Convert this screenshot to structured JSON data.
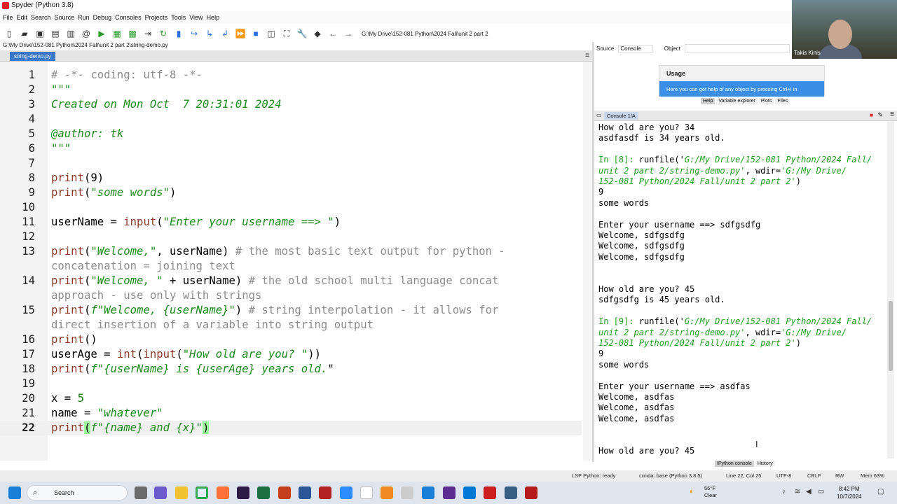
{
  "window": {
    "title": "Spyder (Python 3.8)"
  },
  "menu": [
    "File",
    "Edit",
    "Search",
    "Source",
    "Run",
    "Debug",
    "Consoles",
    "Projects",
    "Tools",
    "View",
    "Help"
  ],
  "toolbar": {
    "path": "G:\\My Drive\\152-081 Python\\2024 Fall\\unit 2 part 2"
  },
  "editor": {
    "file_path": "G:\\My Drive\\152-081 Python\\2024 Fall\\unit 2 part 2\\string-demo.py",
    "tab": "string-demo.py",
    "lines": [
      {
        "n": "1",
        "t": "# -*- coding: utf-8 -*-"
      },
      {
        "n": "2",
        "t": "\"\"\""
      },
      {
        "n": "3",
        "t": "Created on Mon Oct  7 20:31:01 2024"
      },
      {
        "n": "4",
        "t": ""
      },
      {
        "n": "5",
        "t": "@author: tk"
      },
      {
        "n": "6",
        "t": "\"\"\""
      },
      {
        "n": "7",
        "t": ""
      },
      {
        "n": "8",
        "t": "print(9)"
      },
      {
        "n": "9",
        "t": "print(\"some words\")"
      },
      {
        "n": "10",
        "t": ""
      },
      {
        "n": "11",
        "t": "userName = input(\"Enter your username ==> \")"
      },
      {
        "n": "12",
        "t": ""
      },
      {
        "n": "13",
        "t": "print(\"Welcome,\", userName) # the most basic text output for python -"
      },
      {
        "n": "",
        "t": "concatenation = joining text"
      },
      {
        "n": "14",
        "t": "print(\"Welcome, \" + userName) # the old school multi language concat"
      },
      {
        "n": "",
        "t": "approach - use only with strings"
      },
      {
        "n": "15",
        "t": "print(f\"Welcome, {userName}\") # string interpolation - it allows for"
      },
      {
        "n": "",
        "t": "direct insertion of a variable into string output"
      },
      {
        "n": "16",
        "t": "print()"
      },
      {
        "n": "17",
        "t": "userAge = int(input(\"How old are you? \"))"
      },
      {
        "n": "18",
        "t": "print(f\"{userName} is {userAge} years old.\")"
      },
      {
        "n": "19",
        "t": ""
      },
      {
        "n": "20",
        "t": "x = 5"
      },
      {
        "n": "21",
        "t": "name = \"whatever\""
      },
      {
        "n": "22",
        "t": "print(f\"{name} and {x}\")"
      }
    ]
  },
  "help": {
    "source_label": "Source",
    "source_value": "Console",
    "object_label": "Object",
    "usage_title": "Usage",
    "usage_text": "Here you can get help of any object by pressing Ctrl+I in",
    "tabs": [
      "Help",
      "Variable explorer",
      "Plots",
      "Files"
    ]
  },
  "console": {
    "tab": "Console 1/A",
    "lines": [
      "How old are you? 34",
      "asdfasdf is 34 years old.",
      "",
      "In [8]: runfile('G:/My Drive/152-081 Python/2024 Fall/",
      "unit 2 part 2/string-demo.py', wdir='G:/My Drive/",
      "152-081 Python/2024 Fall/unit 2 part 2')",
      "9",
      "some words",
      "",
      "Enter your username ==> sdfgsdfg",
      "Welcome, sdfgsdfg",
      "Welcome, sdfgsdfg",
      "Welcome, sdfgsdfg",
      "",
      "",
      "How old are you? 45",
      "sdfgsdfg is 45 years old.",
      "",
      "In [9]: runfile('G:/My Drive/152-081 Python/2024 Fall/",
      "unit 2 part 2/string-demo.py', wdir='G:/My Drive/",
      "152-081 Python/2024 Fall/unit 2 part 2')",
      "9",
      "some words",
      "",
      "Enter your username ==> asdfas",
      "Welcome, asdfas",
      "Welcome, asdfas",
      "Welcome, asdfas",
      "",
      "",
      "How old are you? 45"
    ],
    "bottom_tabs": [
      "IPython console",
      "History"
    ]
  },
  "status": {
    "lsp": "LSP Python: ready",
    "conda": "conda: base (Python 3.8.5)",
    "position": "Line 22, Col 25",
    "encoding": "UTF-8",
    "eol": "CRLF",
    "rw": "RW",
    "mem": "Mem 63%"
  },
  "taskbar": {
    "search": "Search",
    "weather_temp": "55°F",
    "weather_desc": "Clear",
    "time": "8:42 PM",
    "date": "10/7/2024"
  },
  "webcam": {
    "name": "Takis Kinis"
  }
}
